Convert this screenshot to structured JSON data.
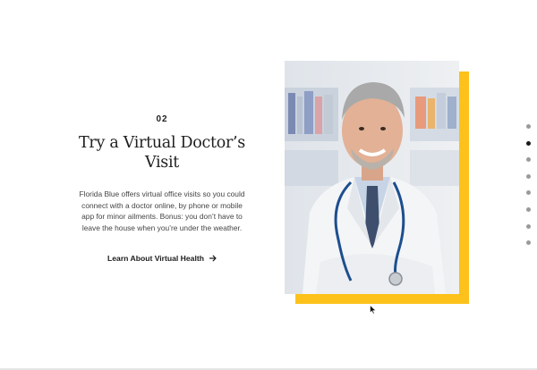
{
  "section": {
    "step_number": "02",
    "headline_line1": "Try a Virtual Doctor’s",
    "headline_line2": "Visit",
    "body": "Florida Blue offers virtual office visits so you could connect with a doctor online, by phone or mobile app for minor ailments. Bonus: you don’t have to leave the house when you’re under the weather.",
    "cta_label": "Learn About Virtual Health"
  },
  "image": {
    "subject": "smiling doctor in white coat with stethoscope",
    "accent_color": "#fcc21b"
  },
  "pagination": {
    "total": 8,
    "active_index": 1
  },
  "icons": {
    "cta_arrow": "arrow-right-icon",
    "cursor": "mouse-pointer-icon"
  }
}
